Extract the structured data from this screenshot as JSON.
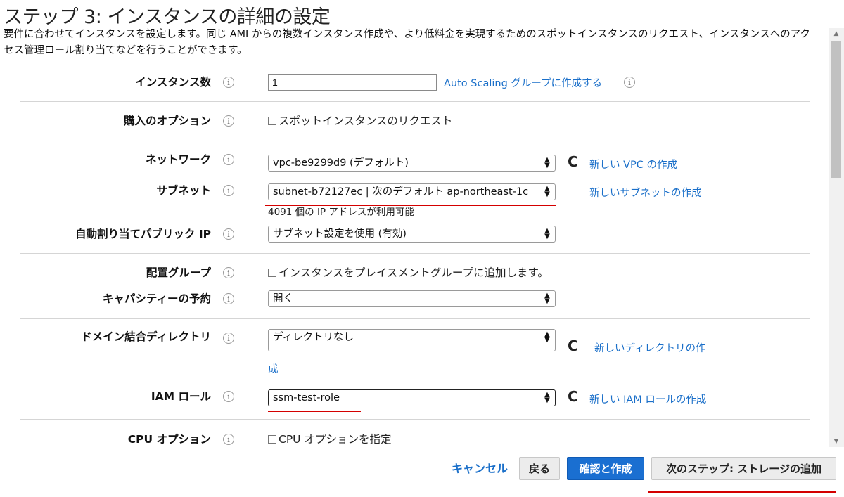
{
  "page": {
    "title": "ステップ 3: インスタンスの詳細の設定",
    "description": "要件に合わせてインスタンスを設定します。同じ AMI からの複数インスタンス作成や、より低料金を実現するためのスポットインスタンスのリクエスト、インスタンスへのアクセス管理ロール割り当てなどを行うことができます。"
  },
  "form": {
    "instance_count": {
      "label": "インスタンス数",
      "value": "1",
      "link": "Auto Scaling グループに作成する"
    },
    "purchase_option": {
      "label": "購入のオプション",
      "checkbox": "スポットインスタンスのリクエスト"
    },
    "network": {
      "label": "ネットワーク",
      "value": "vpc-be9299d9 (デフォルト)",
      "link": "新しい VPC の作成"
    },
    "subnet": {
      "label": "サブネット",
      "value": "subnet-b72127ec | 次のデフォルト ap-northeast-1c",
      "link": "新しいサブネットの作成",
      "subtext": "4091 個の IP アドレスが利用可能"
    },
    "public_ip": {
      "label": "自動割り当てパブリック IP",
      "value": "サブネット設定を使用 (有効)"
    },
    "placement": {
      "label": "配置グループ",
      "checkbox": "インスタンスをプレイスメントグループに追加します。"
    },
    "capacity": {
      "label": "キャパシティーの予約",
      "value": "開く"
    },
    "domain": {
      "label": "ドメイン結合ディレクトリ",
      "value": "ディレクトリなし",
      "link": "新しいディレクトリの作",
      "link_cont": "成"
    },
    "iam": {
      "label": "IAM ロール",
      "value": "ssm-test-role",
      "link": "新しい IAM ロールの作成"
    },
    "cpu": {
      "label": "CPU オプション",
      "checkbox": "CPU オプションを指定"
    }
  },
  "icons": {
    "info": "i",
    "refresh": "C"
  },
  "footer": {
    "cancel": "キャンセル",
    "back": "戻る",
    "review": "確認と作成",
    "next": "次のステップ: ストレージの追加"
  },
  "colors": {
    "link": "#1a6fc9",
    "primary": "#1a6fd1",
    "highlight": "#d40000"
  }
}
